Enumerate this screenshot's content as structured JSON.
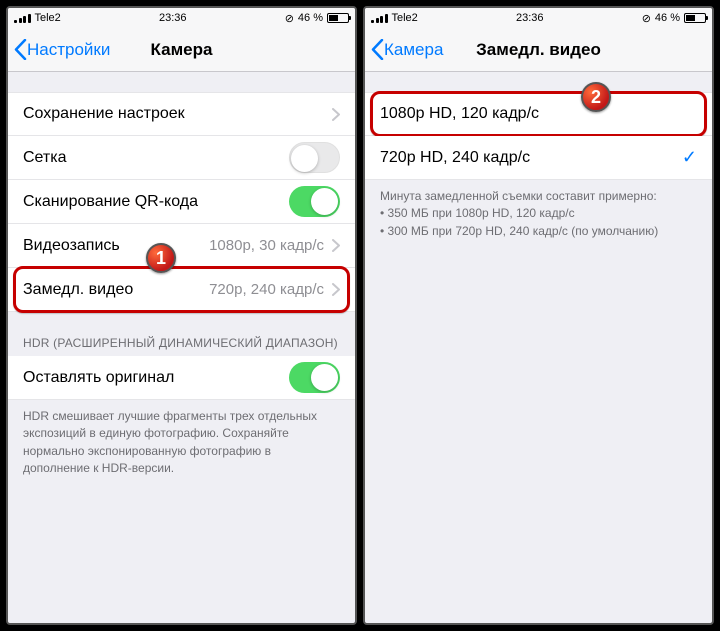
{
  "status": {
    "carrier": "Tele2",
    "time": "23:36",
    "battery": "46 %"
  },
  "left": {
    "back": "Настройки",
    "title": "Камера",
    "rows": {
      "save": "Сохранение настроек",
      "grid": "Сетка",
      "qr": "Сканирование QR-кода",
      "video": {
        "label": "Видеозапись",
        "value": "1080p, 30 кадр/с"
      },
      "slomo": {
        "label": "Замедл. видео",
        "value": "720p, 240 кадр/с"
      }
    },
    "hdr_header": "HDR (РАСШИРЕННЫЙ ДИНАМИЧЕСКИЙ ДИАПАЗОН)",
    "hdr_row": "Оставлять оригинал",
    "hdr_footer": "HDR смешивает лучшие фрагменты трех отдельных экспозиций в единую фотографию. Сохраняйте нормально экспонированную фотографию в дополнение к HDR-версии.",
    "badge": "1"
  },
  "right": {
    "back": "Камера",
    "title": "Замедл. видео",
    "options": {
      "o1": "1080p HD, 120 кадр/с",
      "o2": "720p HD, 240 кадр/с"
    },
    "footer_intro": "Минута замедленной съемки составит примерно:",
    "footer_b1": "350 МБ при 1080p HD, 120 кадр/с",
    "footer_b2": "300 МБ при 720p HD, 240 кадр/с (по умолчанию)",
    "badge": "2"
  }
}
